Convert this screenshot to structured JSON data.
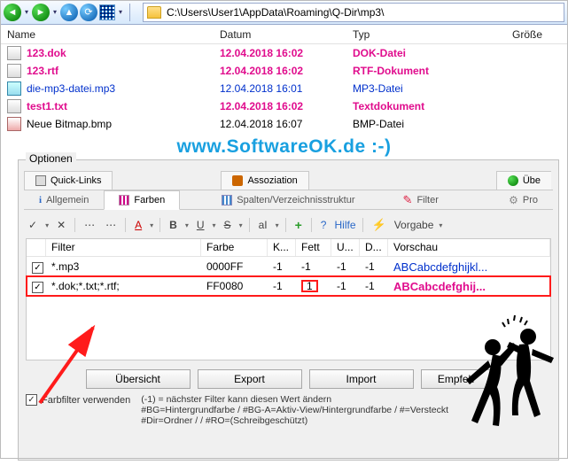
{
  "toolbar": {
    "path": "C:\\Users\\User1\\AppData\\Roaming\\Q-Dir\\mp3\\"
  },
  "file_header": {
    "name": "Name",
    "date": "Datum",
    "type": "Typ",
    "size": "Größe"
  },
  "files": [
    {
      "name": "123.dok",
      "date": "12.04.2018 16:02",
      "type": "DOK-Datei",
      "pink": true,
      "icon": "doc"
    },
    {
      "name": "123.rtf",
      "date": "12.04.2018 16:02",
      "type": "RTF-Dokument",
      "pink": true,
      "icon": "doc"
    },
    {
      "name": "die-mp3-datei.mp3",
      "date": "12.04.2018 16:01",
      "type": "MP3-Datei",
      "pink": false,
      "icon": "mus"
    },
    {
      "name": "test1.txt",
      "date": "12.04.2018 16:02",
      "type": "Textdokument",
      "pink": true,
      "icon": "doc"
    },
    {
      "name": "Neue Bitmap.bmp",
      "date": "12.04.2018 16:07",
      "type": "BMP-Datei",
      "pink": false,
      "icon": "imgf"
    }
  ],
  "watermark": "www.SoftwareOK.de :-)",
  "options": {
    "label": "Optionen",
    "tabs1": {
      "quick": "Quick-Links",
      "assoz": "Assoziation",
      "uber": "Übe"
    },
    "tabs2": {
      "allg": "Allgemein",
      "farben": "Farben",
      "spalten": "Spalten/Verzeichnisstruktur",
      "filter": "Filter",
      "pro": "Pro"
    },
    "fmt": {
      "help": "Hilfe",
      "vorgabe": "Vorgabe"
    },
    "filter_header": {
      "filter": "Filter",
      "color": "Farbe",
      "k": "K...",
      "bold": "Fett",
      "u": "U...",
      "d": "D...",
      "preview": "Vorschau"
    },
    "filters": [
      {
        "pattern": "*.mp3",
        "color": "0000FF",
        "k": "-1",
        "bold": "-1",
        "u": "-1",
        "d": "-1",
        "preview": "ABCabcdefghijkl...",
        "pclass": "prev1"
      },
      {
        "pattern": "*.dok;*.txt;*.rtf;",
        "color": "FF0080",
        "k": "-1",
        "bold": "1",
        "u": "-1",
        "d": "-1",
        "preview": "ABCabcdefghij...",
        "pclass": "prev2"
      }
    ],
    "buttons": {
      "overview": "Übersicht",
      "export": "Export",
      "import": "Import",
      "rec": "Empfeh"
    },
    "footer": {
      "useColorFilter": "Farbfilter verwenden",
      "hint1": "(-1) = nächster Filter kann diesen Wert ändern",
      "hint2": "#BG=Hintergrundfarbe / #BG-A=Aktiv-View/Hintergrundfarbe / #=Versteckt",
      "hint3": "#Dir=Ordner /  / #RO=(Schreibgeschützt)"
    }
  }
}
